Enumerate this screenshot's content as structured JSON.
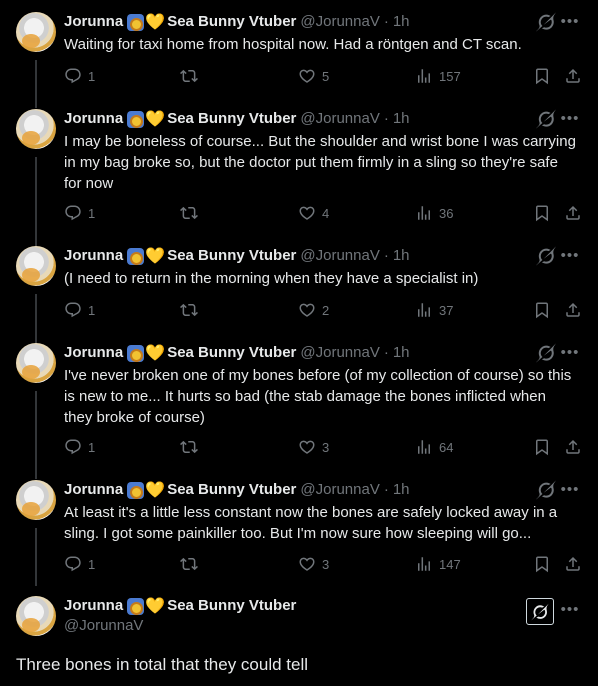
{
  "author": {
    "display_name": "Jorunna",
    "display_name_suffix": "Sea Bunny Vtuber",
    "handle": "@JorunnaV",
    "separator": "·"
  },
  "icons": {
    "reply": "reply-icon",
    "retweet": "retweet-icon",
    "like": "heart-icon",
    "views": "views-icon",
    "bookmark": "bookmark-icon",
    "share": "share-icon",
    "grok": "grok-icon",
    "more": "more-icon",
    "emoji_snail": "snail-emoji-icon",
    "emoji_heart": "yellow-heart-emoji-icon"
  },
  "tweets": [
    {
      "time": "1h",
      "text": "Waiting for taxi home from hospital now. Had a röntgen and CT scan.",
      "replies": "1",
      "retweets": "",
      "likes": "5",
      "views": "157"
    },
    {
      "time": "1h",
      "text": "I may be boneless of course... But the shoulder and wrist bone I was carrying in my bag broke so, but the doctor put them firmly in a sling so they're safe for now",
      "replies": "1",
      "retweets": "",
      "likes": "4",
      "views": "36"
    },
    {
      "time": "1h",
      "text": "(I need to return in the morning when they have a specialist in)",
      "replies": "1",
      "retweets": "",
      "likes": "2",
      "views": "37"
    },
    {
      "time": "1h",
      "text": "I've never broken one of my bones before (of my collection of course) so this is new to me... It hurts so bad (the stab damage the bones inflicted when they broke of course)",
      "replies": "1",
      "retweets": "",
      "likes": "3",
      "views": "64"
    },
    {
      "time": "1h",
      "text": "At least it's a little less constant now the bones are safely locked away in a sling. I got some painkiller too. But I'm now sure how sleeping will go...",
      "replies": "1",
      "retweets": "",
      "likes": "3",
      "views": "147"
    }
  ],
  "focused_tweet": {
    "text": "Three bones in total that they could tell"
  }
}
